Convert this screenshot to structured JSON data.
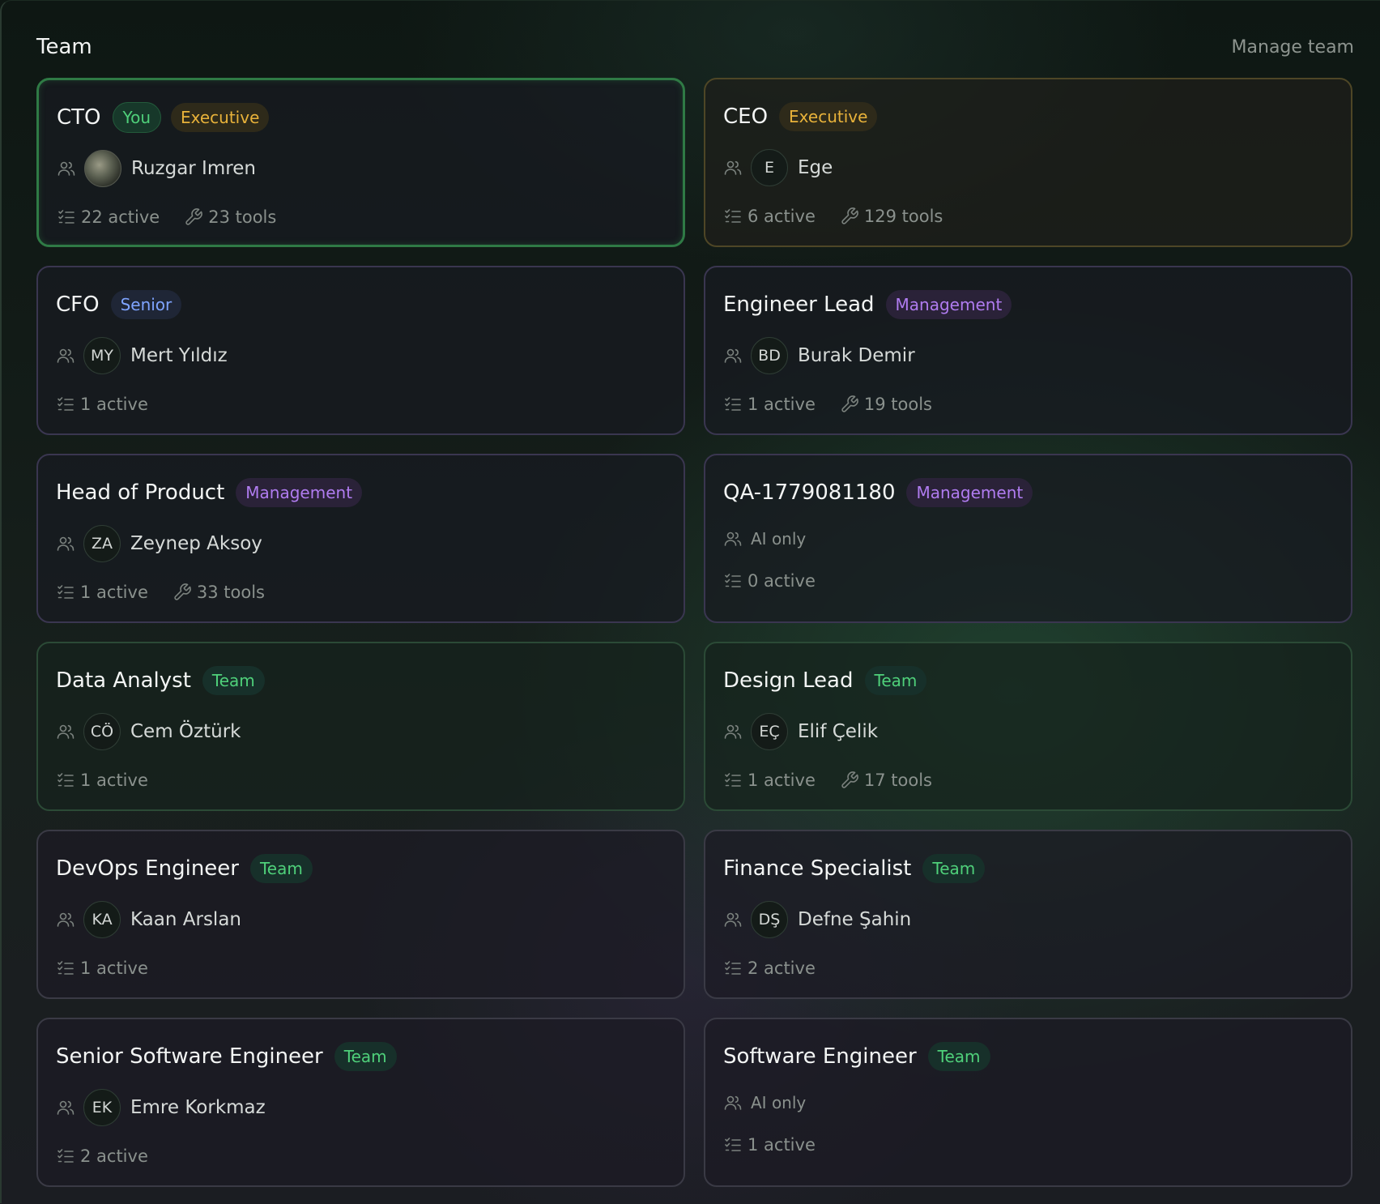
{
  "header": {
    "title": "Team",
    "manage_label": "Manage team"
  },
  "cards": [
    {
      "role": "CTO",
      "badges": [
        {
          "label": "You",
          "type": "you"
        },
        {
          "label": "Executive",
          "type": "executive"
        }
      ],
      "style": "you",
      "person": {
        "name": "Ruzgar Imren",
        "initials": "",
        "photo": true
      },
      "active": "22 active",
      "tools": "23 tools"
    },
    {
      "role": "CEO",
      "badges": [
        {
          "label": "Executive",
          "type": "executive"
        }
      ],
      "style": "exec",
      "person": {
        "name": "Ege",
        "initials": "E"
      },
      "active": "6 active",
      "tools": "129 tools"
    },
    {
      "role": "CFO",
      "badges": [
        {
          "label": "Senior",
          "type": "senior"
        }
      ],
      "style": "mgmt",
      "person": {
        "name": "Mert Yıldız",
        "initials": "MY"
      },
      "active": "1 active",
      "tools": ""
    },
    {
      "role": "Engineer Lead",
      "badges": [
        {
          "label": "Management",
          "type": "management"
        }
      ],
      "style": "mgmt",
      "person": {
        "name": "Burak Demir",
        "initials": "BD"
      },
      "active": "1 active",
      "tools": "19 tools"
    },
    {
      "role": "Head of Product",
      "badges": [
        {
          "label": "Management",
          "type": "management"
        }
      ],
      "style": "mgmt",
      "person": {
        "name": "Zeynep Aksoy",
        "initials": "ZA"
      },
      "active": "1 active",
      "tools": "33 tools"
    },
    {
      "role": "QA-1779081180",
      "badges": [
        {
          "label": "Management",
          "type": "management"
        }
      ],
      "style": "mgmt",
      "ai_only": "AI only",
      "active": "0 active",
      "tools": ""
    },
    {
      "role": "Data Analyst",
      "badges": [
        {
          "label": "Team",
          "type": "team"
        }
      ],
      "style": "team",
      "person": {
        "name": "Cem Öztürk",
        "initials": "CÖ"
      },
      "active": "1 active",
      "tools": ""
    },
    {
      "role": "Design Lead",
      "badges": [
        {
          "label": "Team",
          "type": "team"
        }
      ],
      "style": "team",
      "person": {
        "name": "Elif Çelik",
        "initials": "EÇ"
      },
      "active": "1 active",
      "tools": "17 tools"
    },
    {
      "role": "DevOps Engineer",
      "badges": [
        {
          "label": "Team",
          "type": "team"
        }
      ],
      "style": "team dark",
      "person": {
        "name": "Kaan Arslan",
        "initials": "KA"
      },
      "active": "1 active",
      "tools": ""
    },
    {
      "role": "Finance Specialist",
      "badges": [
        {
          "label": "Team",
          "type": "team"
        }
      ],
      "style": "team dark",
      "person": {
        "name": "Defne Şahin",
        "initials": "DŞ"
      },
      "active": "2 active",
      "tools": ""
    },
    {
      "role": "Senior Software Engineer",
      "badges": [
        {
          "label": "Team",
          "type": "team"
        }
      ],
      "style": "team dark",
      "person": {
        "name": "Emre Korkmaz",
        "initials": "EK"
      },
      "active": "2 active",
      "tools": ""
    },
    {
      "role": "Software Engineer",
      "badges": [
        {
          "label": "Team",
          "type": "team"
        }
      ],
      "style": "team dark",
      "ai_only": "AI only",
      "active": "1 active",
      "tools": ""
    }
  ],
  "icons": {
    "people": "users-icon",
    "tasks": "list-checks-icon",
    "tools": "wrench-icon"
  }
}
